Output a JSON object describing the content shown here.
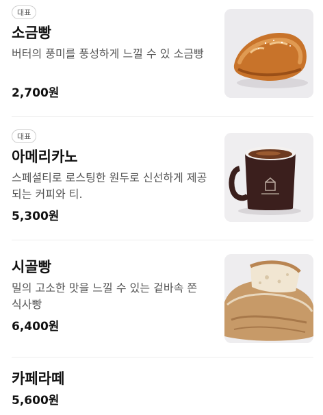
{
  "menu": {
    "items": [
      {
        "badge": "대표",
        "name": "소금빵",
        "description": "버터의 풍미를 풍성하게 느낄 수 있 소금빵",
        "price": "2,700원",
        "image": "salt-bread-image"
      },
      {
        "badge": "대표",
        "name": "아메리카노",
        "description": "스페셜티로 로스팅한 원두로 신선하게 제공되는 커피와 티.",
        "price": "5,300원",
        "image": "americano-mug-image"
      },
      {
        "name": "시골빵",
        "description": "밀의 고소한 맛을 느낄 수 있는 겉바속 쫀 식사빵",
        "price": "6,400원",
        "image": "country-bread-image"
      },
      {
        "name": "카페라떼",
        "price": "5,600원"
      }
    ]
  }
}
